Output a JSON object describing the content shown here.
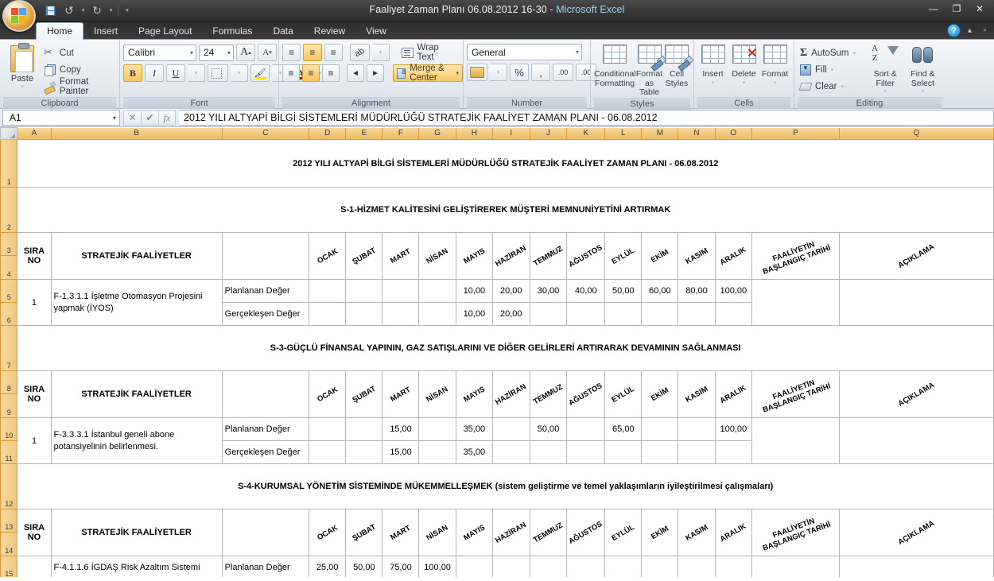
{
  "window": {
    "title": "Faaliyet Zaman Planı 06.08.2012 16-30  -  Microsoft Excel",
    "title_doc": "Faaliyet Zaman Planı 06.08.2012 16-30",
    "title_sep": "  -  ",
    "title_app": "Microsoft Excel",
    "minimize": "—",
    "maximize": "❐",
    "close": "✕"
  },
  "quick_access": {
    "save": "Save",
    "undo": "↶",
    "redo": "↷",
    "customize": "⌄"
  },
  "tabs": [
    {
      "label": "Home",
      "active": true
    },
    {
      "label": "Insert",
      "active": false
    },
    {
      "label": "Page Layout",
      "active": false
    },
    {
      "label": "Formulas",
      "active": false
    },
    {
      "label": "Data",
      "active": false
    },
    {
      "label": "Review",
      "active": false
    },
    {
      "label": "View",
      "active": false
    }
  ],
  "tab_right": {
    "help": "?",
    "minimize_ribbon": "▴",
    "restore": "▫"
  },
  "ribbon": {
    "clipboard": {
      "group_label": "Clipboard",
      "paste": "Paste",
      "cut": "Cut",
      "copy": "Copy",
      "format_painter": "Format Painter"
    },
    "font": {
      "group_label": "Font",
      "font_name": "Calibri",
      "font_size": "24",
      "grow": "A",
      "shrink": "A",
      "bold": "B",
      "italic": "I",
      "underline": "U",
      "borders": "▦",
      "fill_color": "A",
      "font_color": "A"
    },
    "alignment": {
      "group_label": "Alignment",
      "wrap_text": "Wrap Text",
      "merge_center": "Merge & Center",
      "orientation": "ab",
      "decrease_indent": "◄",
      "increase_indent": "►"
    },
    "number": {
      "group_label": "Number",
      "format": "General",
      "accounting": "$",
      "percent": "%",
      "comma": ",",
      "increase_decimal": ".00",
      "decrease_decimal": ".00"
    },
    "styles": {
      "group_label": "Styles",
      "conditional_formatting": "Conditional Formatting",
      "format_as_table": "Format as Table",
      "cell_styles": "Cell Styles"
    },
    "cells": {
      "group_label": "Cells",
      "insert": "Insert",
      "delete": "Delete",
      "format": "Format"
    },
    "editing": {
      "group_label": "Editing",
      "autosum": "AutoSum",
      "fill": "Fill",
      "clear": "Clear",
      "sort_filter": "Sort & Filter",
      "find_select": "Find & Select"
    }
  },
  "formula_bar": {
    "name_box": "A1",
    "cancel": "✕",
    "enter": "✔",
    "insert_function": "fx",
    "value": "2012 YILI ALTYAPİ BİLGİ SİSTEMLERİ  MÜDÜRLÜĞÜ STRATEJİK FAALİYET ZAMAN PLANI - 06.08.2012"
  },
  "grid": {
    "column_headers": [
      "A",
      "B",
      "C",
      "D",
      "E",
      "F",
      "G",
      "H",
      "I",
      "J",
      "K",
      "L",
      "M",
      "N",
      "O",
      "P",
      "Q"
    ],
    "row_headers": [
      "1",
      "2",
      "3",
      "4",
      "5",
      "6",
      "7",
      "8",
      "9",
      "10",
      "11",
      "12",
      "13",
      "14",
      "15"
    ],
    "title": "2012 YILI ALTYAPİ BİLGİ SİSTEMLERİ  MÜDÜRLÜĞÜ STRATEJİK FAALİYET ZAMAN PLANI - 06.08.2012",
    "sections": [
      {
        "id": "S-1",
        "heading": "S-1-HİZMET KALİTESİNİ GELİŞTİREREK  MÜŞTERİ MEMNUNİYETİNİ ARTIRMAK"
      },
      {
        "id": "S-3",
        "heading": "S-3-GÜÇLÜ FİNANSAL YAPININ, GAZ SATIŞLARINI VE DİĞER GELİRLERİ ARTIRARAK DEVAMININ SAĞLANMASI"
      },
      {
        "id": "S-4",
        "heading": "S-4-KURUMSAL YÖNETİM SİSTEMİNDE MÜKEMMELLEŞMEK (sistem geliştirme ve temel yaklaşımların iyileştirilmesi çalışmaları)"
      }
    ],
    "headers": {
      "sira_no": "SIRA NO",
      "activities": "STRATEJİK FAALİYETLER",
      "blank": "",
      "months": [
        "OCAK",
        "ŞUBAT",
        "MART",
        "NİSAN",
        "MAYIS",
        "HAZİRAN",
        "TEMMUZ",
        "AĞUSTOS",
        "EYLÜL",
        "EKİM",
        "KASIM",
        "ARALIK"
      ],
      "start_date_l1": "FAALİYETİN",
      "start_date_l2": "BAŞLANGIÇ TARİHİ",
      "description": "AÇIKLAMA"
    },
    "row_labels": {
      "planned": "Planlanan Değer",
      "actual": "Gerçekleşen Değer"
    },
    "blocks": [
      {
        "section": "S-1",
        "sira_no": "1",
        "activity": "F-1.3.1.1 İşletme Otomasyon Projesini yapmak (İYOS)",
        "planned": [
          "",
          "",
          "",
          "",
          "10,00",
          "20,00",
          "30,00",
          "40,00",
          "50,00",
          "60,00",
          "80,00",
          "100,00"
        ],
        "actual": [
          "",
          "",
          "",
          "",
          "10,00",
          "20,00",
          "",
          "",
          "",
          "",
          "",
          ""
        ],
        "start_date": "",
        "description": ""
      },
      {
        "section": "S-3",
        "sira_no": "1",
        "activity": "F-3.3.3.1 İstanbul geneli abone potansiyelinin belirlenmesi.",
        "planned": [
          "",
          "",
          "15,00",
          "",
          "35,00",
          "",
          "50,00",
          "",
          "65,00",
          "",
          "",
          "100,00"
        ],
        "actual": [
          "",
          "",
          "15,00",
          "",
          "35,00",
          "",
          "",
          "",
          "",
          "",
          "",
          ""
        ],
        "start_date": "",
        "description": ""
      },
      {
        "section": "S-4",
        "sira_no": "",
        "activity": "F-4.1.1.6 İGDAŞ Risk Azaltım Sistemi",
        "planned": [
          "25,00",
          "50,00",
          "75,00",
          "100,00",
          "",
          "",
          "",
          "",
          "",
          "",
          "",
          ""
        ],
        "actual": [
          "",
          "",
          "",
          "",
          "",
          "",
          "",
          "",
          "",
          "",
          "",
          ""
        ],
        "start_date": "",
        "description": ""
      }
    ]
  },
  "colors": {
    "title_fill": "#0f6cb5",
    "section_fill": "#5586c8",
    "header_fill": "#c3d8ee",
    "planned_fill": "#d9d9d9",
    "actual_fill": "#0b8a1f",
    "ribbon_accent": "#f8c45e"
  }
}
